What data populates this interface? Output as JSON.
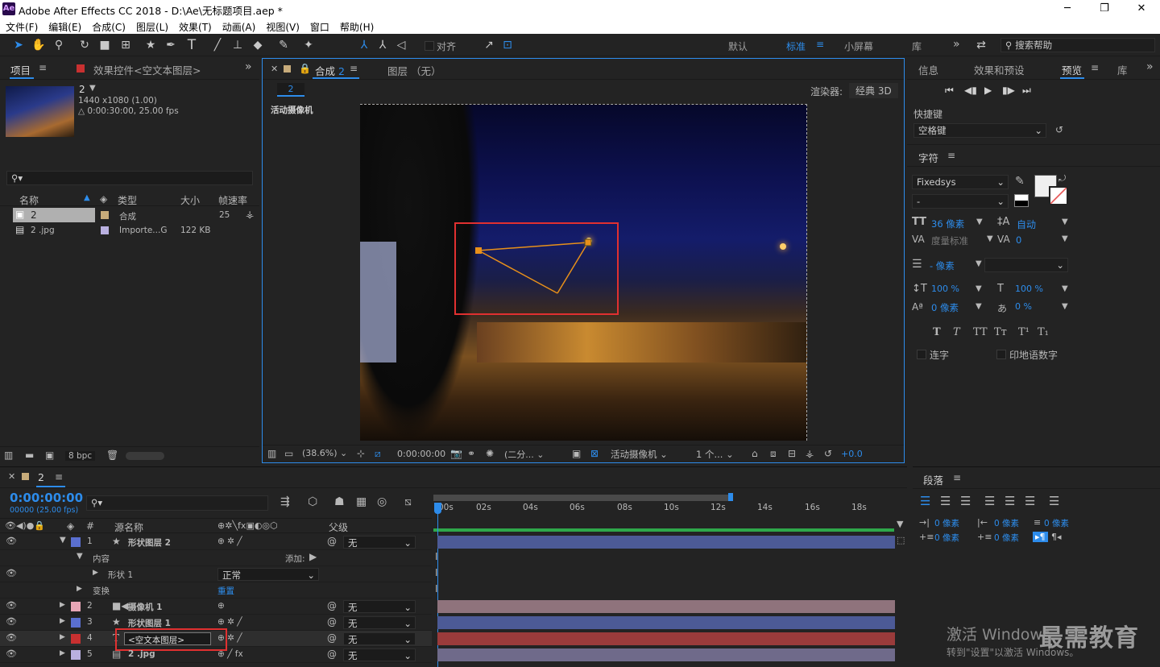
{
  "window": {
    "title": "Adobe After Effects CC 2018 - D:\\Ae\\无标题项目.aep *",
    "app_icon": "Ae"
  },
  "menu": [
    "文件(F)",
    "编辑(E)",
    "合成(C)",
    "图层(L)",
    "效果(T)",
    "动画(A)",
    "视图(V)",
    "窗口",
    "帮助(H)"
  ],
  "toolbar": {
    "align_label": "对齐",
    "workspaces": [
      "默认",
      "标准",
      "小屏幕",
      "库"
    ],
    "active_workspace": "标准",
    "search_placeholder": "搜索帮助"
  },
  "project": {
    "tab": "项目",
    "effects_tab": "效果控件<空文本图层>",
    "comp_name": "2",
    "comp_size": "1440 x1080 (1.00)",
    "comp_duration": "△ 0:00:30:00, 25.00 fps",
    "columns": [
      "名称",
      "类型",
      "大小",
      "帧速率"
    ],
    "items": [
      {
        "name": "2",
        "type": "合成",
        "size": "",
        "fps": "25"
      },
      {
        "name": "2 .jpg",
        "type": "Importe...G",
        "size": "122 KB",
        "fps": ""
      }
    ],
    "bpc": "8 bpc"
  },
  "viewer": {
    "tab_comp": "合成",
    "tab_comp_name": "2",
    "tab_layer": "图层 （无）",
    "breadcrumb": "2",
    "renderer_label": "渲染器:",
    "renderer_value": "经典 3D",
    "camera_label": "活动摄像机",
    "zoom": "(38.6%)",
    "timecode": "0:00:00:00",
    "resolution": "(二分...",
    "view": "活动摄像机",
    "views": "1 个...",
    "exposure": "+0.0",
    "accent": "#2d8ceb"
  },
  "right": {
    "tabs": [
      "信息",
      "效果和预设",
      "预览",
      "库"
    ],
    "active_tab": "预览",
    "shortcut_label": "快捷键",
    "shortcut_value": "空格键",
    "char_title": "字符",
    "font": "Fixedsys",
    "font_style": "-",
    "font_size": "36 像素",
    "leading": "自动",
    "kerning": "度量标准",
    "tracking": "0",
    "stroke": "- 像素",
    "vscale": "100 %",
    "hscale": "100 %",
    "baseline": "0 像素",
    "tsume": "0 %",
    "ligature": "连字",
    "hindi": "印地语数字",
    "para_title": "段落",
    "indent": [
      "0 像素",
      "0 像素",
      "0 像素",
      "0 像素",
      "0 像素"
    ]
  },
  "timeline": {
    "tab": "2",
    "timecode": "0:00:00:00",
    "frames": "00000 (25.00 fps)",
    "col_source": "源名称",
    "col_parent": "父级",
    "ruler": [
      "00s",
      "02s",
      "04s",
      "06s",
      "08s",
      "10s",
      "12s",
      "14s",
      "16s",
      "18s"
    ],
    "layers": [
      {
        "num": "1",
        "name": "形状图层 2",
        "parent": "无",
        "color": "#5a6fd0",
        "bar": "#4c5a96",
        "kind": "shape"
      },
      {
        "num": "2",
        "name": "摄像机 1",
        "parent": "无",
        "color": "#e7a6b6",
        "bar": "#8f737c",
        "kind": "camera"
      },
      {
        "num": "3",
        "name": "形状图层 1",
        "parent": "无",
        "color": "#5a6fd0",
        "bar": "#4c5a96",
        "kind": "shape"
      },
      {
        "num": "4",
        "name": "<空文本图层>",
        "parent": "无",
        "color": "#c83030",
        "bar": "#9a3b3b",
        "kind": "text"
      },
      {
        "num": "5",
        "name": "2 .jpg",
        "parent": "无",
        "color": "#b9b0e0",
        "bar": "#6f6a8a",
        "kind": "footage"
      }
    ],
    "content_label": "内容",
    "add_label": "添加:",
    "shape_label": "形状 1",
    "blend_mode": "正常",
    "transform_label": "变换",
    "reset_label": "重置"
  },
  "watermark": {
    "line1": "激活 Windows",
    "line2": "转到\"设置\"以激活 Windows。",
    "brand": "最需教育"
  }
}
